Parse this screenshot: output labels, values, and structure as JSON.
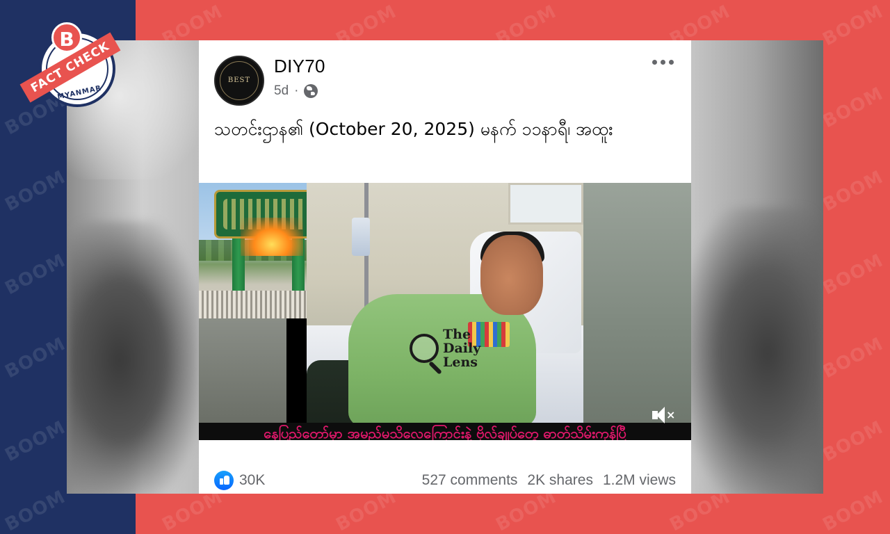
{
  "badge": {
    "logo_letter": "B",
    "ribbon_text": "FACT CHECK",
    "country": "MYANMAR",
    "brand_color": "#e8534f",
    "navy_color": "#1f3163"
  },
  "watermark_text": "BOOM",
  "post": {
    "page_name": "DIY70",
    "avatar_text": "BEST",
    "time": "5d",
    "separator": "·",
    "privacy_icon": "globe-icon",
    "more_icon": "more-options-icon",
    "caption": "သတင်းဌာန၏ (October 20, 2025) မနက် ၁၁နာရီ၊ အထူး",
    "media": {
      "overlay_logo_line1": "The",
      "overlay_logo_line2": "Daily",
      "overlay_logo_line3": "Lens",
      "banner_text": "နေပြည်တော်မှာ အမည်မသိလေကြောင်းနဲ့ ဗိုလ်ချုပ်တွေ ဓာတ်သိမ်းကုန်ပြီ",
      "banner_color": "#e0186b",
      "mute_icon": "speaker-muted-icon"
    },
    "stats": {
      "reactions": "30K",
      "comments": "527 comments",
      "shares": "2K shares",
      "views": "1.2M views"
    }
  }
}
